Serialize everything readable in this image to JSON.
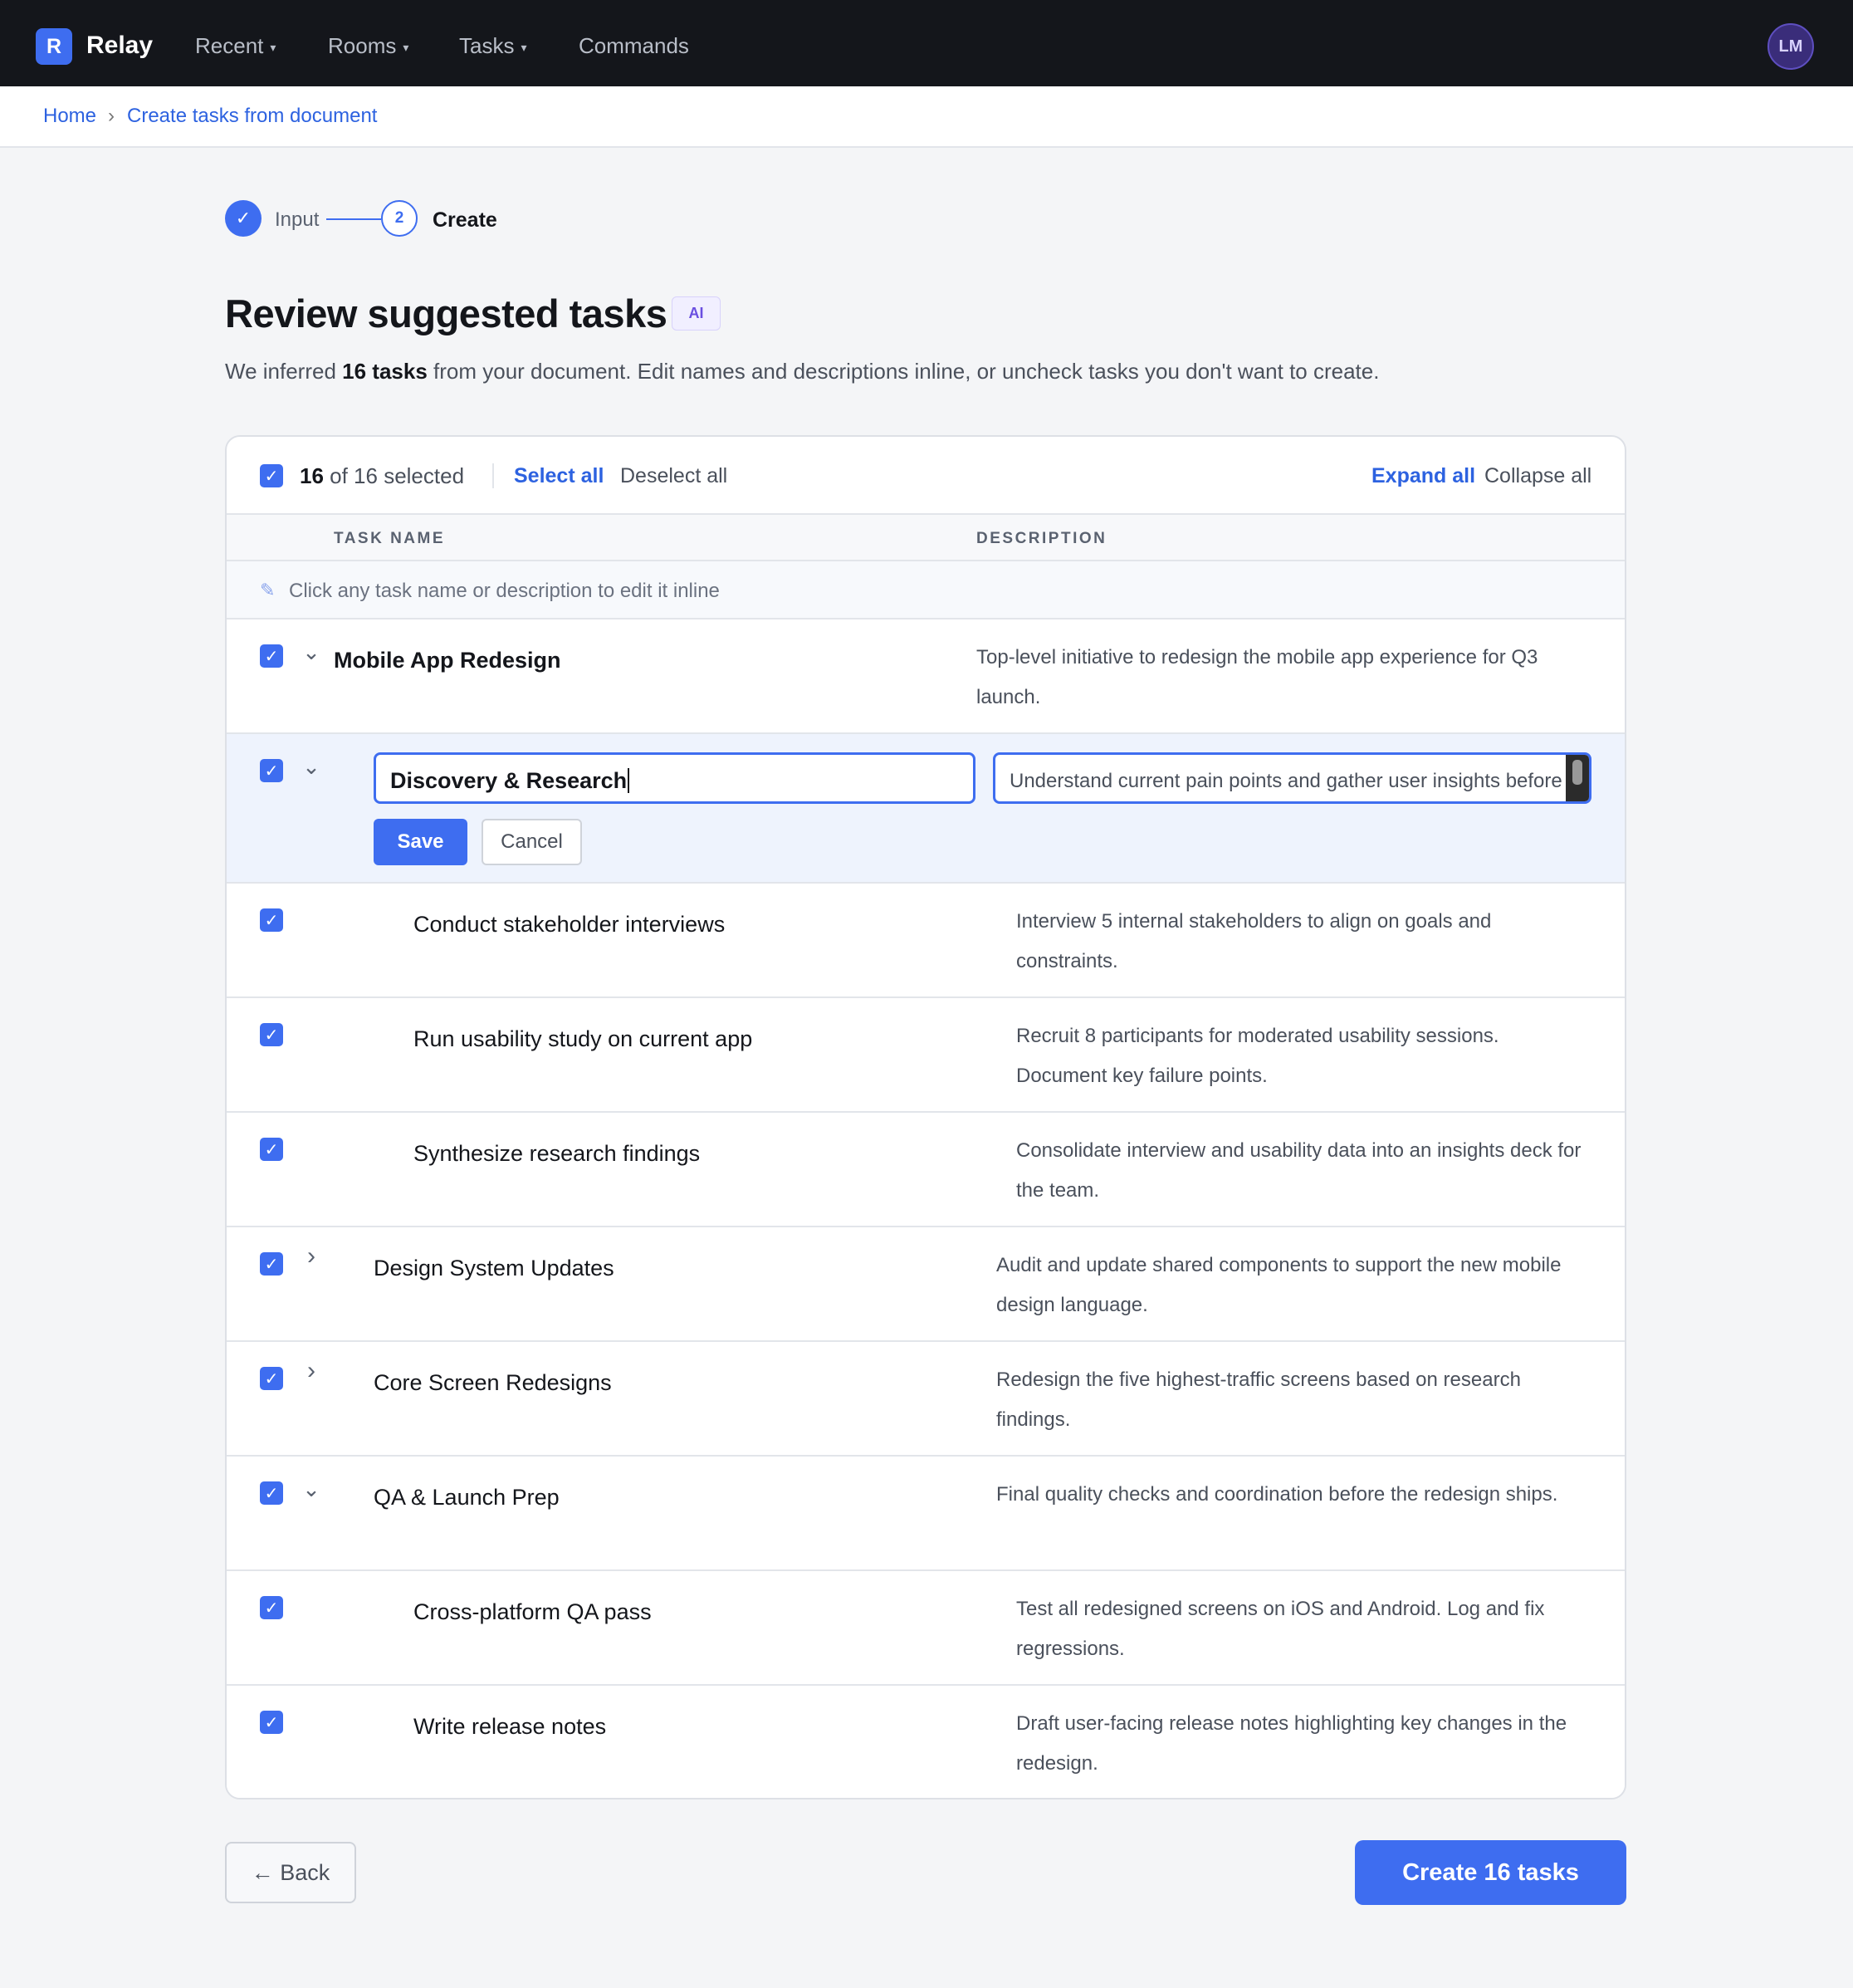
{
  "app": {
    "logo_letter": "R",
    "name": "Relay",
    "avatar_initials": "LM"
  },
  "nav": [
    {
      "label": "Recent",
      "caret": "▾"
    },
    {
      "label": "Rooms",
      "caret": "▾"
    },
    {
      "label": "Tasks",
      "caret": "▾"
    },
    {
      "label": "Commands"
    }
  ],
  "breadcrumb": {
    "home": "Home",
    "separator": "›",
    "current": "Create tasks from document"
  },
  "stepper": {
    "step1_label": "Input",
    "step1_icon": "✓",
    "step2_number": "2",
    "step2_label": "Create"
  },
  "page": {
    "title": "Review suggested tasks",
    "badge": "AI",
    "subtitle_prefix": "We inferred ",
    "subtitle_count": "16 tasks",
    "subtitle_suffix": " from your document. Edit names and descriptions inline, or uncheck tasks you don't want to create."
  },
  "selection": {
    "selected": "16",
    "of_total": " of 16 selected",
    "select_all": "Select all",
    "deselect_all": "Deselect all",
    "expand_all": "Expand all",
    "collapse_all": "Collapse all"
  },
  "columns": {
    "name": "TASK NAME",
    "description": "DESCRIPTION"
  },
  "hint": {
    "icon": "✎",
    "text": "Click any task name or description to edit it inline"
  },
  "editing": {
    "name_value": "Discovery & Research",
    "description_value": "Understand current pain points and gather user insights before redesigning.",
    "save_label": "Save",
    "cancel_label": "Cancel"
  },
  "tasks": [
    {
      "name": "Mobile App Redesign",
      "description": "Top-level initiative to redesign the mobile app experience for Q3 launch.",
      "chevron": "⌄"
    },
    {
      "name": "Conduct stakeholder interviews",
      "description": "Interview 5 internal stakeholders to align on goals and constraints."
    },
    {
      "name": "Run usability study on current app",
      "description": "Recruit 8 participants for moderated usability sessions. Document key failure points."
    },
    {
      "name": "Synthesize research findings",
      "description": "Consolidate interview and usability data into an insights deck for the team."
    },
    {
      "name": "Design System Updates",
      "description": "Audit and update shared components to support the new mobile design language.",
      "chevron": "›"
    },
    {
      "name": "Core Screen Redesigns",
      "description": "Redesign the five highest-traffic screens based on research findings.",
      "chevron": "›"
    },
    {
      "name": "QA & Launch Prep",
      "description": "Final quality checks and coordination before the redesign ships.",
      "chevron": "⌄"
    },
    {
      "name": "Cross-platform QA pass",
      "description": "Test all redesigned screens on iOS and Android. Log and fix regressions."
    },
    {
      "name": "Write release notes",
      "description": "Draft user-facing release notes highlighting key changes in the redesign."
    }
  ],
  "footer": {
    "back_label": "← Back",
    "create_label": "Create 16 tasks"
  },
  "colors": {
    "accent": "#3e6df0",
    "topbar": "#14161b",
    "link": "#2d62e0"
  }
}
